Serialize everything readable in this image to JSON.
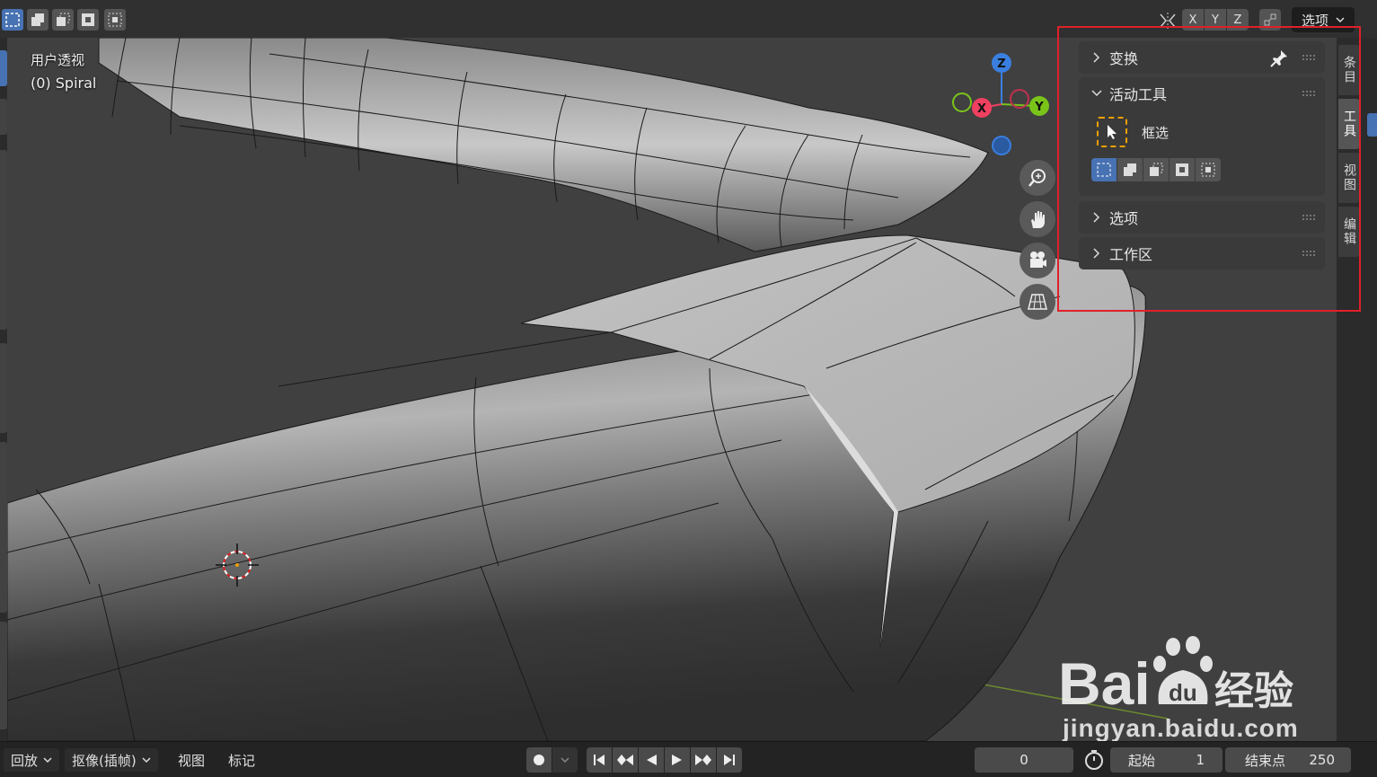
{
  "viewport": {
    "view_label": "用户透视",
    "object_label": "(0) Spiral",
    "header": {
      "axis_x": "X",
      "axis_y": "Y",
      "axis_z": "Z",
      "options_label": "选项"
    },
    "gizmo": {
      "x": "X",
      "y": "Y",
      "z": "Z",
      "colors": {
        "x": "#f04060",
        "y": "#7ac41a",
        "z": "#3a7fdf"
      }
    }
  },
  "n_panel": {
    "transform_label": "变换",
    "active_tool_label": "活动工具",
    "tool_name": "框选",
    "options_label": "选项",
    "workspace_label": "工作区",
    "tabs": [
      "条目",
      "工具",
      "视图",
      "编辑"
    ],
    "active_tab": "工具"
  },
  "timeline": {
    "playback_label": "回放",
    "keying_label": "抠像(插帧)",
    "view_label": "视图",
    "marker_label": "标记",
    "current_frame": "0",
    "start_label": "起始",
    "start_value": "1",
    "end_label": "结束点",
    "end_value": "250"
  },
  "watermark": {
    "logo_text": "Bai",
    "logo_du": "du",
    "logo_cn": "经验",
    "url": "jingyan.baidu.com"
  },
  "colors": {
    "accent": "#4772b3",
    "highlight_box": "#e0202a",
    "tool_outline": "#f0a000"
  }
}
